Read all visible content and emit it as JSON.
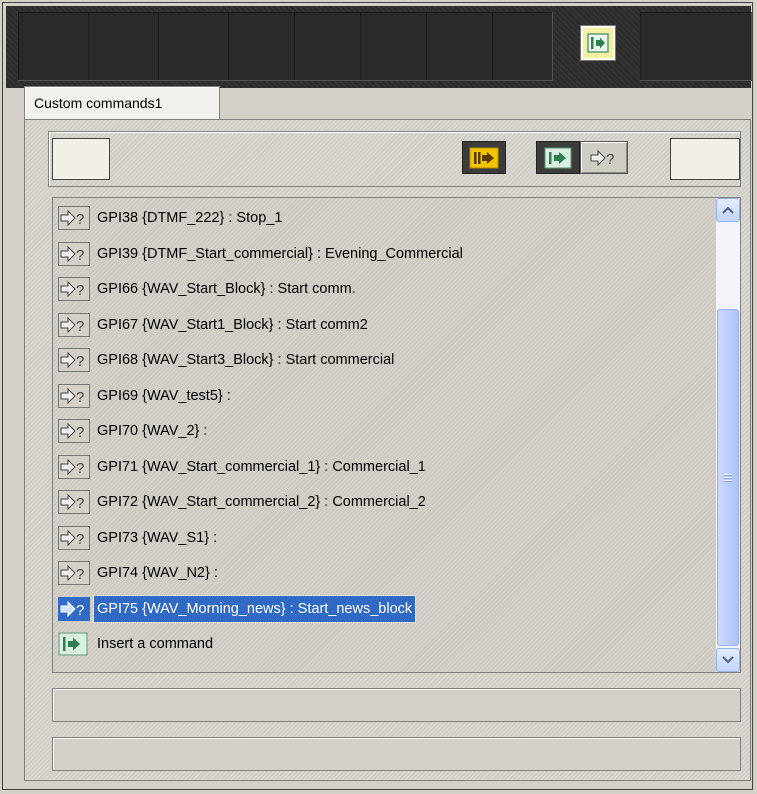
{
  "tabs": [
    {
      "label": "Custom commands1"
    }
  ],
  "list": {
    "items": [
      {
        "label": "GPI38 {DTMF_222} : Stop_1",
        "icon": "query-command-icon",
        "selected": false
      },
      {
        "label": "GPI39 {DTMF_Start_commercial} : Evening_Commercial",
        "icon": "query-command-icon",
        "selected": false
      },
      {
        "label": "GPI66 {WAV_Start_Block} : Start comm.",
        "icon": "query-command-icon",
        "selected": false
      },
      {
        "label": "GPI67 {WAV_Start1_Block} : Start comm2",
        "icon": "query-command-icon",
        "selected": false
      },
      {
        "label": "GPI68 {WAV_Start3_Block} : Start commercial",
        "icon": "query-command-icon",
        "selected": false
      },
      {
        "label": "GPI69 {WAV_test5} :",
        "icon": "query-command-icon",
        "selected": false
      },
      {
        "label": "GPI70 {WAV_2} :",
        "icon": "query-command-icon",
        "selected": false
      },
      {
        "label": "GPI71 {WAV_Start_commercial_1} : Commercial_1",
        "icon": "query-command-icon",
        "selected": false
      },
      {
        "label": "GPI72 {WAV_Start_commercial_2} : Commercial_2",
        "icon": "query-command-icon",
        "selected": false
      },
      {
        "label": "GPI73 {WAV_S1} :",
        "icon": "query-command-icon",
        "selected": false
      },
      {
        "label": "GPI74 {WAV_N2} :",
        "icon": "query-command-icon",
        "selected": false
      },
      {
        "label": "GPI75 {WAV_Morning_news} : Start_news_block",
        "icon": "query-command-icon",
        "selected": true
      },
      {
        "label": "Insert a command",
        "icon": "insert-command-icon",
        "selected": false
      }
    ]
  },
  "colors": {
    "selection": "#316ac5",
    "top_button": "#f3f0a5",
    "toolbar_dark": "#2e2e2e",
    "accent_yellow": "#f4c400"
  }
}
